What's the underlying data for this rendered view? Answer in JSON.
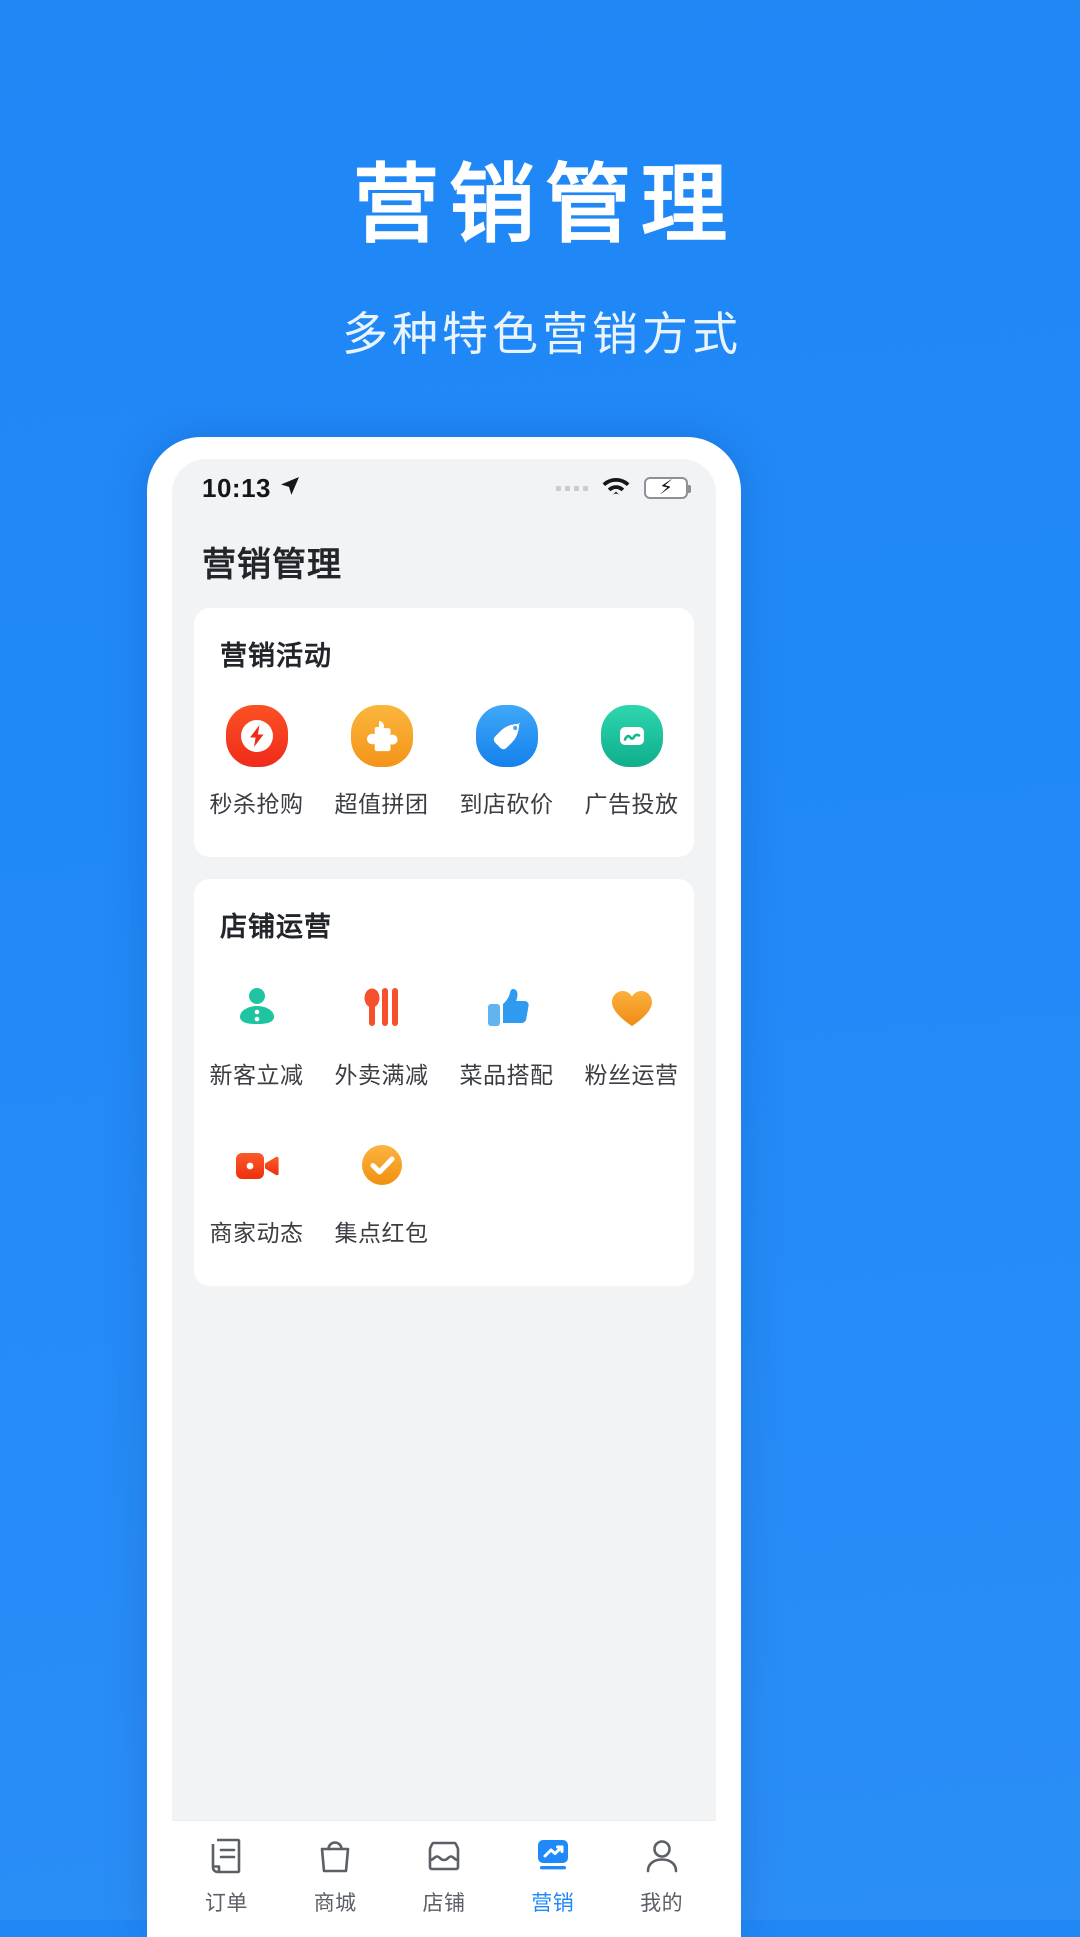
{
  "promo": {
    "title": "营销管理",
    "subtitle": "多种特色营销方式"
  },
  "statusbar": {
    "time": "10:13",
    "location_icon": "location-arrow-icon",
    "signal_icon": "signal-dots-icon",
    "wifi_icon": "wifi-icon",
    "battery_icon": "battery-charging-icon"
  },
  "appbar": {
    "title": "营销管理"
  },
  "sections": [
    {
      "title": "营销活动",
      "items": [
        {
          "label": "秒杀抢购",
          "icon": "lightning-bolt-icon",
          "color": "#f5402c"
        },
        {
          "label": "超值拼团",
          "icon": "puzzle-piece-icon",
          "color": "#f9a522"
        },
        {
          "label": "到店砍价",
          "icon": "price-tag-icon",
          "color": "#2196f3"
        },
        {
          "label": "广告投放",
          "icon": "ad-chart-icon",
          "color": "#14c29a"
        }
      ]
    },
    {
      "title": "店铺运营",
      "items": [
        {
          "label": "新客立减",
          "icon": "new-customer-icon",
          "color": "#1fc5a0"
        },
        {
          "label": "外卖满减",
          "icon": "cutlery-icon",
          "color": "#f5502c"
        },
        {
          "label": "菜品搭配",
          "icon": "thumbs-up-icon",
          "color": "#2e9bf0"
        },
        {
          "label": "粉丝运营",
          "icon": "heart-icon",
          "color": "#f9a226"
        },
        {
          "label": "商家动态",
          "icon": "video-camera-icon",
          "color": "#f5441f"
        },
        {
          "label": "集点红包",
          "icon": "check-circle-icon",
          "color": "#f9a522"
        }
      ]
    }
  ],
  "tabbar": {
    "active_color": "#2089f8",
    "inactive_color": "#5b5f66",
    "tabs": [
      {
        "label": "订单",
        "icon": "receipt-icon",
        "active": false
      },
      {
        "label": "商城",
        "icon": "shopping-bag-icon",
        "active": false
      },
      {
        "label": "店铺",
        "icon": "store-icon",
        "active": false
      },
      {
        "label": "营销",
        "icon": "trending-chart-icon",
        "active": true
      },
      {
        "label": "我的",
        "icon": "person-icon",
        "active": false
      }
    ]
  }
}
